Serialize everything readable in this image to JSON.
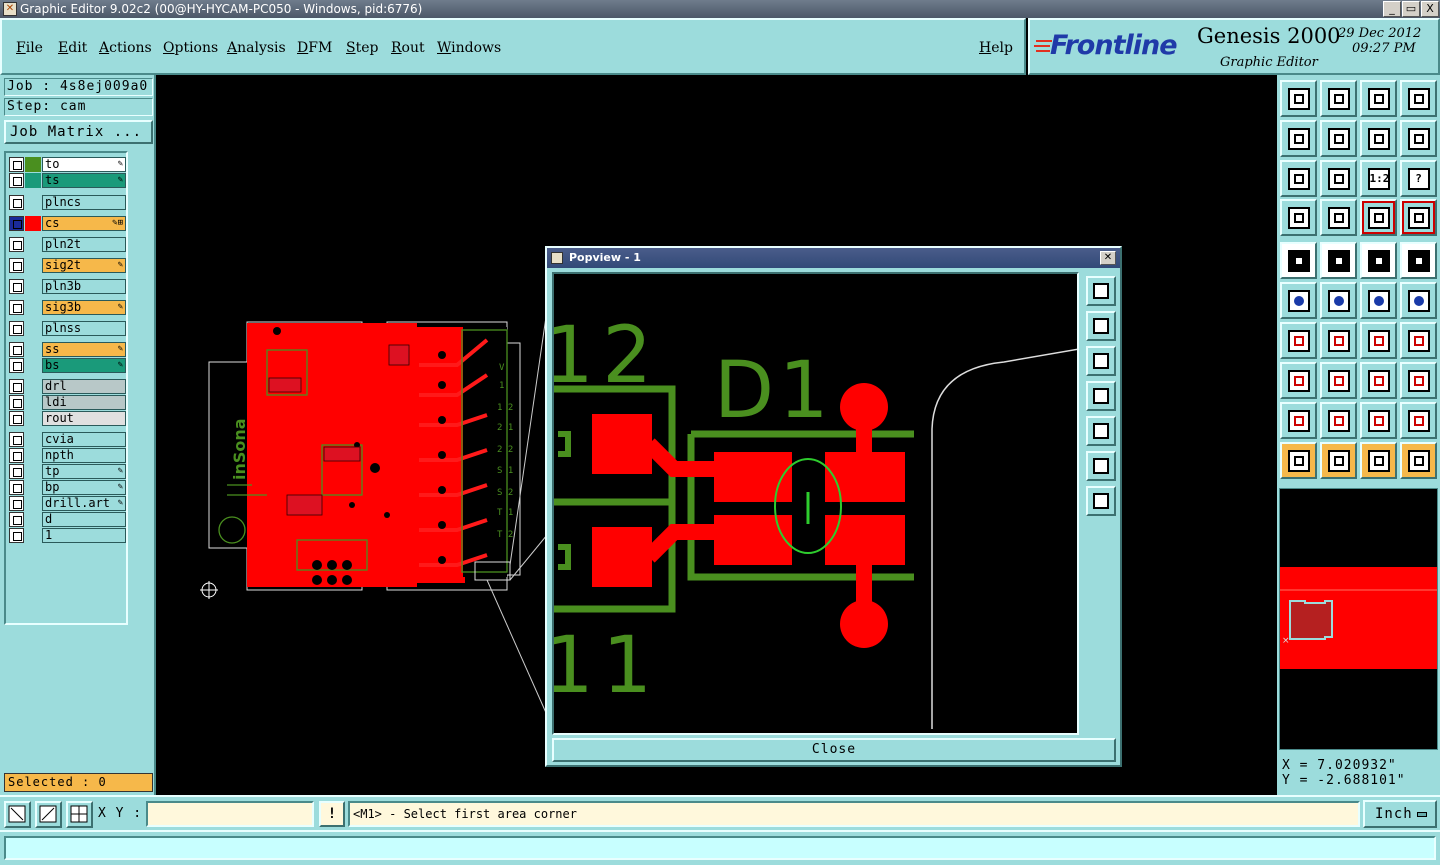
{
  "window": {
    "title": "Graphic Editor 9.02c2 (00@HY-HYCAM-PC050 - Windows, pid:6776)",
    "controls": [
      "_",
      "▭",
      "X"
    ]
  },
  "menu": {
    "items": [
      "File",
      "Edit",
      "Actions",
      "Options",
      "Analysis",
      "DFM",
      "Step",
      "Rout",
      "Windows"
    ],
    "help": "Help"
  },
  "brand": {
    "logo": "Frontline",
    "product": "Genesis 2000",
    "subtitle": "Graphic Editor",
    "date": "29 Dec 2012",
    "time": "09:27 PM"
  },
  "job": {
    "job_line": "Job : 4s8ej009a0",
    "step_line": "Step: cam",
    "matrix_button": "Job Matrix ..."
  },
  "layers": [
    {
      "name": "to",
      "color": "#4a8f1f",
      "name_bg": "#ffffff",
      "flag": "✎"
    },
    {
      "name": "ts",
      "color": "#1a9a7a",
      "name_bg": "#1a9a7a",
      "flag": "✎"
    },
    {
      "name": "plncs",
      "color": "",
      "name_bg": "#9cdcdc",
      "flag": ""
    },
    {
      "name": "cs",
      "color": "#ff0000",
      "name_bg": "#f6b84a",
      "flag": "✎⊞",
      "active": true
    },
    {
      "name": "pln2t",
      "color": "",
      "name_bg": "#9cdcdc",
      "flag": ""
    },
    {
      "name": "sig2t",
      "color": "",
      "name_bg": "#f6b84a",
      "flag": "✎"
    },
    {
      "name": "pln3b",
      "color": "",
      "name_bg": "#9cdcdc",
      "flag": ""
    },
    {
      "name": "sig3b",
      "color": "",
      "name_bg": "#f6b84a",
      "flag": "✎"
    },
    {
      "name": "plnss",
      "color": "",
      "name_bg": "#9cdcdc",
      "flag": ""
    },
    {
      "name": "ss",
      "color": "",
      "name_bg": "#f6b84a",
      "flag": "✎"
    },
    {
      "name": "bs",
      "color": "",
      "name_bg": "#1a9a7a",
      "flag": "✎"
    },
    {
      "name": "drl",
      "color": "",
      "name_bg": "#b8c8c8",
      "flag": ""
    },
    {
      "name": "ldi",
      "color": "",
      "name_bg": "#b8c8c8",
      "flag": ""
    },
    {
      "name": "rout",
      "color": "",
      "name_bg": "#e0e0e0",
      "flag": ""
    },
    {
      "name": "cvia",
      "color": "",
      "name_bg": "#9cdcdc",
      "flag": ""
    },
    {
      "name": "npth",
      "color": "",
      "name_bg": "#9cdcdc",
      "flag": ""
    },
    {
      "name": "tp",
      "color": "",
      "name_bg": "#9cdcdc",
      "flag": "✎"
    },
    {
      "name": "bp",
      "color": "",
      "name_bg": "#9cdcdc",
      "flag": "✎"
    },
    {
      "name": "drill.art",
      "color": "",
      "name_bg": "#9cdcdc",
      "flag": "✎"
    },
    {
      "name": "d",
      "color": "",
      "name_bg": "#9cdcdc",
      "flag": ""
    },
    {
      "name": "1",
      "color": "",
      "name_bg": "#9cdcdc",
      "flag": ""
    }
  ],
  "selection": {
    "text": "Selected : 0"
  },
  "board": {
    "silk_text": "inSona"
  },
  "popview": {
    "title": "Popview - 1",
    "close_label": "Close",
    "labels": {
      "j2": "1 2",
      "j1": "1 1",
      "d1": "D 1"
    }
  },
  "toolbox": {
    "tools": [
      "zoom-home-icon",
      "zoom-step-icon",
      "home-icon",
      "window-split-icon",
      "pan-left-icon",
      "pan-right-icon",
      "redraw-icon",
      "swap-icon",
      "fit-all-icon",
      "center-icon",
      "scale-1-2-icon",
      "help-icon",
      "measure-ruler-icon",
      "grid-icon",
      "snap-red-icon",
      "snap-red-alt-icon",
      "feature-info-icon",
      "select-box-icon",
      "ruler-icon",
      "dotted-select-icon",
      "connect-nodes-icon",
      "cross-pad-icon",
      "add-line-icon",
      "move-line-icon",
      "angle-icon",
      "draw-line-icon",
      "arc-icon",
      "text-ff-icon",
      "add-pad-icon",
      "line-split-icon",
      "dimension-icon",
      "surface-icon",
      "triangle-plane-icon",
      "triangle-outline-icon",
      "a-frame-icon",
      "triangle-bar-icon",
      "pointer-icon",
      "pointer-box-icon",
      "pointer-alt-icon",
      "pointer-tree-icon"
    ],
    "scale_label": "1:2",
    "help_label": "?"
  },
  "coordinates": {
    "x": "X = 7.020932\"",
    "y": "Y = -2.688101\""
  },
  "status": {
    "xy_label": "X Y :",
    "xy_value": "",
    "warn": "!",
    "prompt": "<M1> - Select first area corner",
    "unit": "Inch"
  }
}
